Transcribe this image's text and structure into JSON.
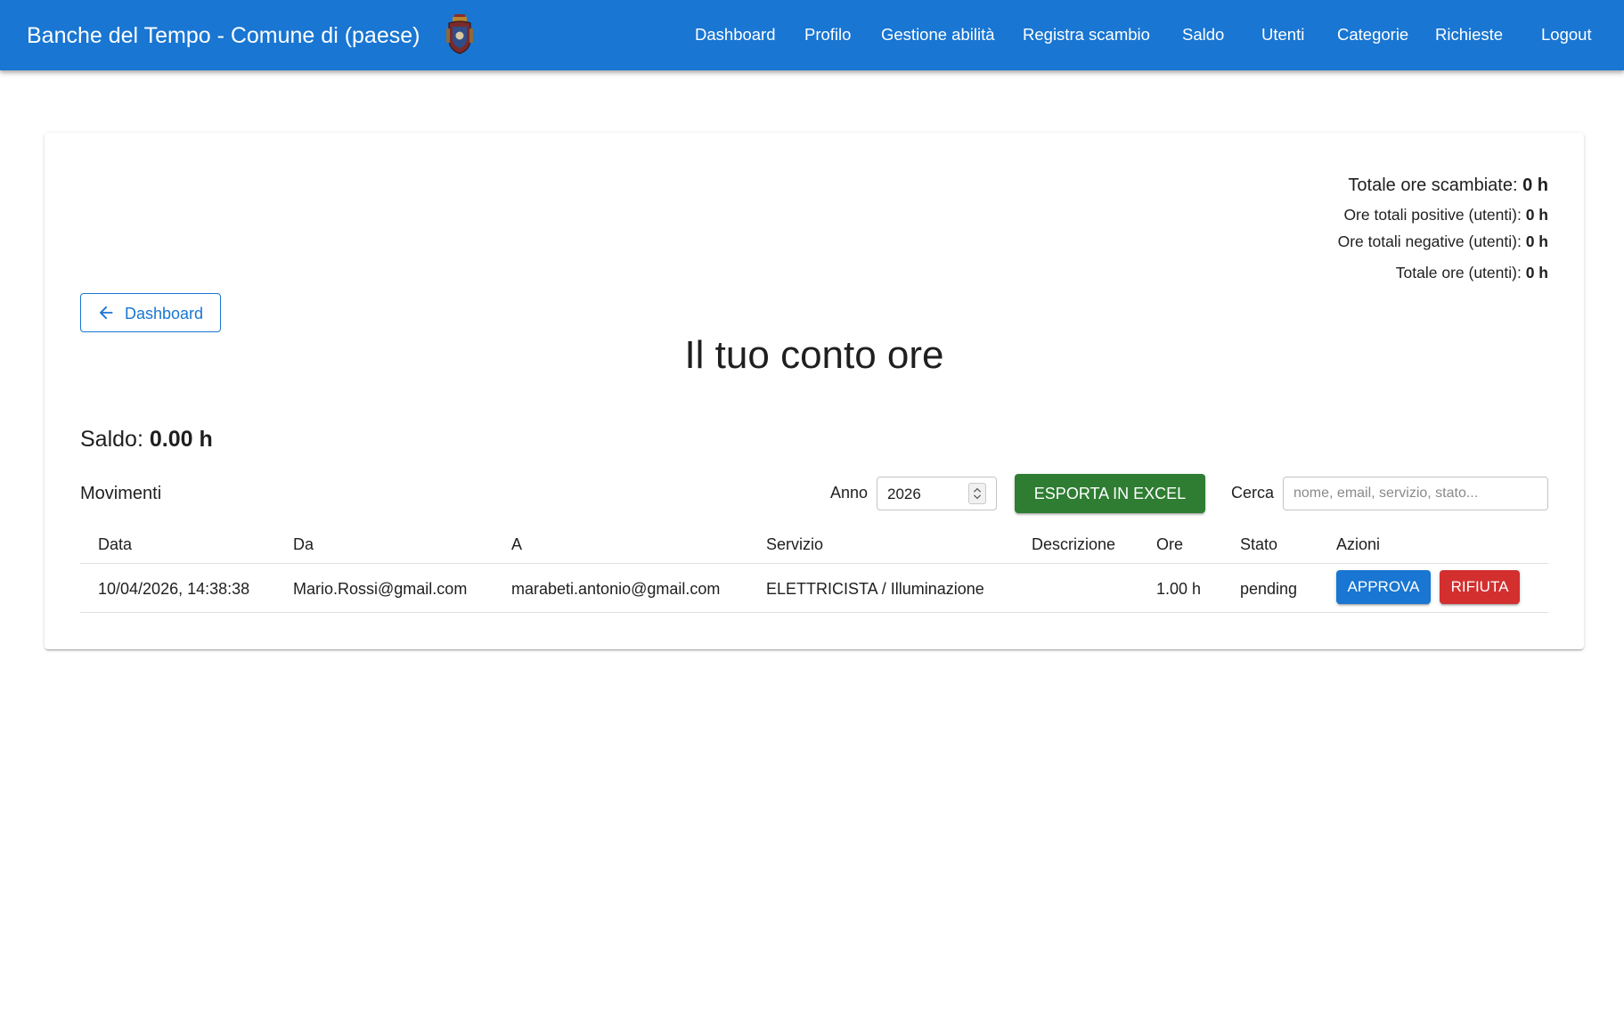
{
  "appbar": {
    "title": "Banche del Tempo - Comune di (paese)",
    "logo_icon": "coat-of-arms-icon",
    "background": "#1976d2",
    "nav": [
      {
        "label": "Dashboard"
      },
      {
        "label": "Profilo"
      },
      {
        "label": "Gestione abilità"
      },
      {
        "label": "Registra scambio"
      },
      {
        "label": "Saldo"
      },
      {
        "label": "Utenti"
      },
      {
        "label": "Categorie"
      },
      {
        "label": "Richieste"
      },
      {
        "label": "Logout"
      }
    ]
  },
  "stats": {
    "totale_scambiate_label": "Totale ore scambiate:",
    "totale_scambiate_value": "0 h",
    "positive_label": "Ore totali positive (utenti):",
    "positive_value": "0 h",
    "negative_label": "Ore totali negative (utenti):",
    "negative_value": "0 h",
    "totale_utenti_label": "Totale ore (utenti):",
    "totale_utenti_value": "0 h"
  },
  "back_button": {
    "label": "Dashboard",
    "icon": "arrow-left-icon"
  },
  "page_title": "Il tuo conto ore",
  "saldo": {
    "label": "Saldo:",
    "value": "0.00 h"
  },
  "movimenti": {
    "label": "Movimenti",
    "anno_label": "Anno",
    "anno_value": "2026",
    "export_label": "ESPORTA IN EXCEL",
    "export_color": "#2e7d32",
    "cerca_label": "Cerca",
    "search_placeholder": "nome, email, servizio, stato..."
  },
  "table": {
    "headers": [
      "Data",
      "Da",
      "A",
      "Servizio",
      "Descrizione",
      "Ore",
      "Stato",
      "Azioni"
    ],
    "rows": [
      {
        "data": "10/04/2026, 14:38:38",
        "da": "Mario.Rossi@gmail.com",
        "a": "marabeti.antonio@gmail.com",
        "servizio": "ELETTRICISTA / Illuminazione",
        "descrizione": "",
        "ore": "1.00 h",
        "stato": "pending",
        "approva_label": "APPROVA",
        "rifiuta_label": "RIFIUTA"
      }
    ]
  },
  "colors": {
    "primary": "#1976d2",
    "success": "#2e7d32",
    "error": "#d32f2f"
  }
}
